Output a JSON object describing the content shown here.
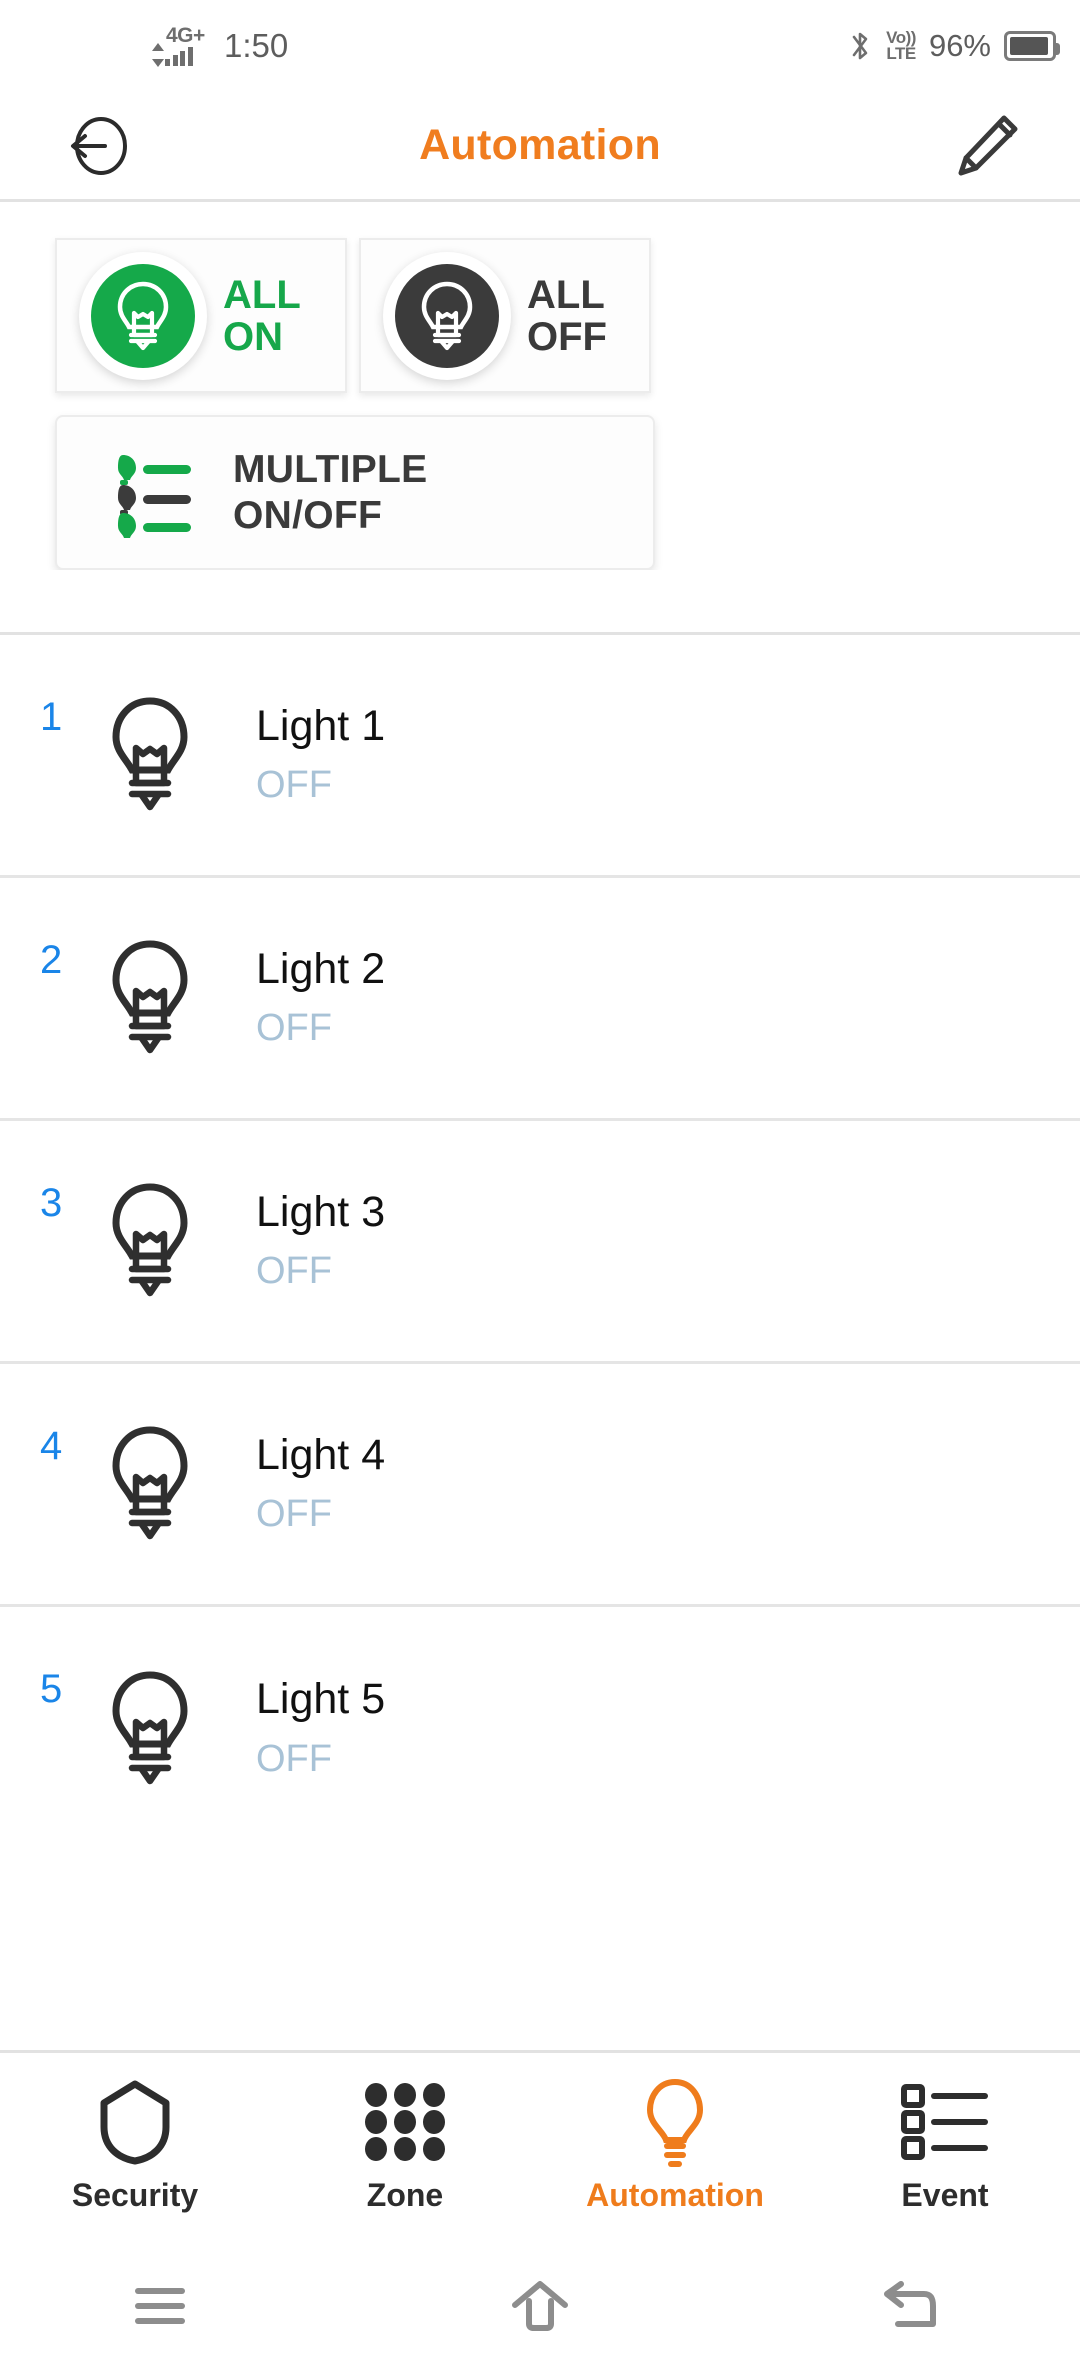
{
  "status_bar": {
    "network_type": "4G+",
    "time": "1:50",
    "bluetooth_icon": "bluetooth-icon",
    "volte_line1": "Vo))",
    "volte_line2": "LTE",
    "battery_percent": "96%",
    "battery_icon": "battery-icon"
  },
  "header": {
    "back_icon": "back-arrow-icon",
    "title": "Automation",
    "edit_icon": "pencil-icon",
    "accent_color": "#f07d1f"
  },
  "quick_actions": {
    "all_on": {
      "label_line1": "ALL",
      "label_line2": "ON",
      "icon": "lightbulb-icon",
      "color": "#15a94a"
    },
    "all_off": {
      "label_line1": "ALL",
      "label_line2": "OFF",
      "icon": "lightbulb-icon",
      "color": "#3b3b3b"
    },
    "multiple": {
      "label_line1": "MULTIPLE",
      "label_line2": "ON/OFF",
      "icon": "multiple-lights-list-icon",
      "on_color": "#15a94a",
      "off_color": "#3b3b3b"
    }
  },
  "lights": [
    {
      "number": "1",
      "name": "Light 1",
      "state": "OFF",
      "icon": "lightbulb-outline-icon"
    },
    {
      "number": "2",
      "name": "Light 2",
      "state": "OFF",
      "icon": "lightbulb-outline-icon"
    },
    {
      "number": "3",
      "name": "Light 3",
      "state": "OFF",
      "icon": "lightbulb-outline-icon"
    },
    {
      "number": "4",
      "name": "Light 4",
      "state": "OFF",
      "icon": "lightbulb-outline-icon"
    },
    {
      "number": "5",
      "name": "Light 5",
      "state": "OFF",
      "icon": "lightbulb-outline-icon"
    }
  ],
  "bottom_nav": {
    "items": [
      {
        "label": "Security",
        "icon": "shield-icon",
        "active": false
      },
      {
        "label": "Zone",
        "icon": "grid-dots-icon",
        "active": false
      },
      {
        "label": "Automation",
        "icon": "lightbulb-icon",
        "active": true
      },
      {
        "label": "Event",
        "icon": "list-squares-icon",
        "active": false
      }
    ],
    "active_color": "#ef7c1c",
    "inactive_color": "#2d2d2d"
  },
  "system_nav": {
    "recents_icon": "menu-icon",
    "home_icon": "home-icon",
    "back_icon": "back-icon"
  }
}
